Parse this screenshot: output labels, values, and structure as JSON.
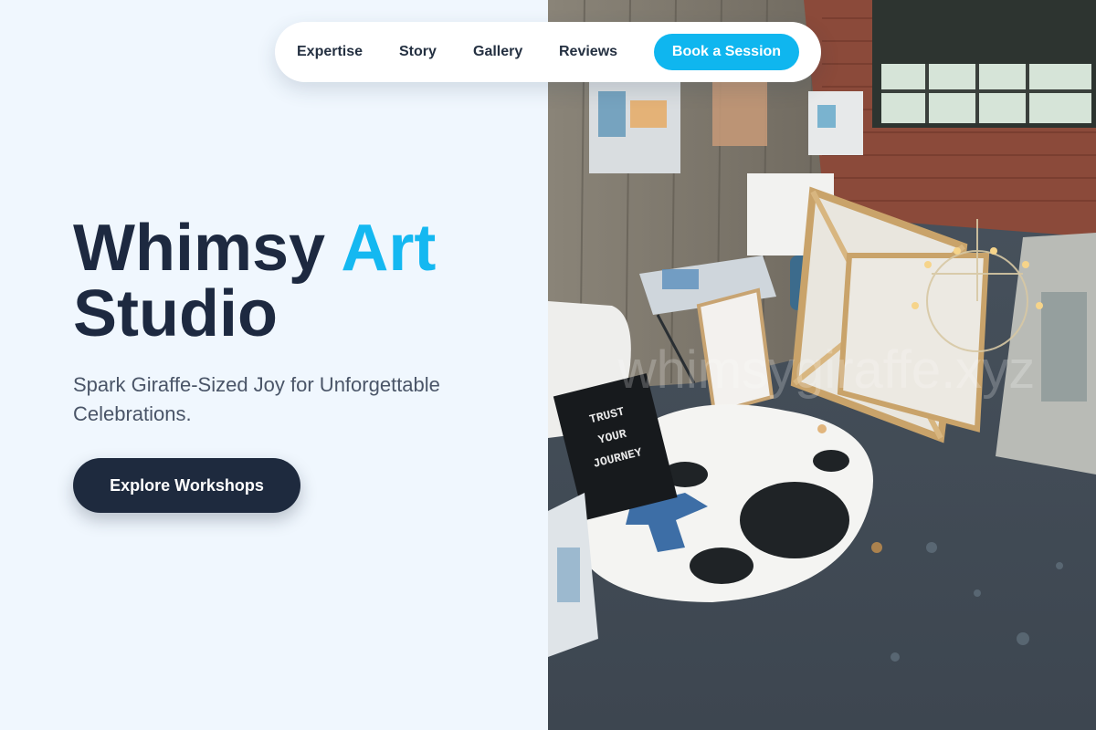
{
  "nav": {
    "links": [
      {
        "label": "Expertise"
      },
      {
        "label": "Story"
      },
      {
        "label": "Gallery"
      },
      {
        "label": "Reviews"
      }
    ],
    "cta_label": "Book a Session"
  },
  "hero": {
    "title_part1": "Whimsy ",
    "title_accent": "Art",
    "title_part2": "Studio",
    "subtitle": "Spark Giraffe-Sized Joy for Unforgettable Celebrations.",
    "cta_label": "Explore Workshops",
    "image_sign_text": [
      "TRUST",
      "YOUR",
      "JOURNEY"
    ],
    "image_watermark": "whimsygiraffe.xyz"
  },
  "colors": {
    "accent": "#14b8f1",
    "primary_dark": "#1e2a3e",
    "background": "#f0f7fe"
  }
}
